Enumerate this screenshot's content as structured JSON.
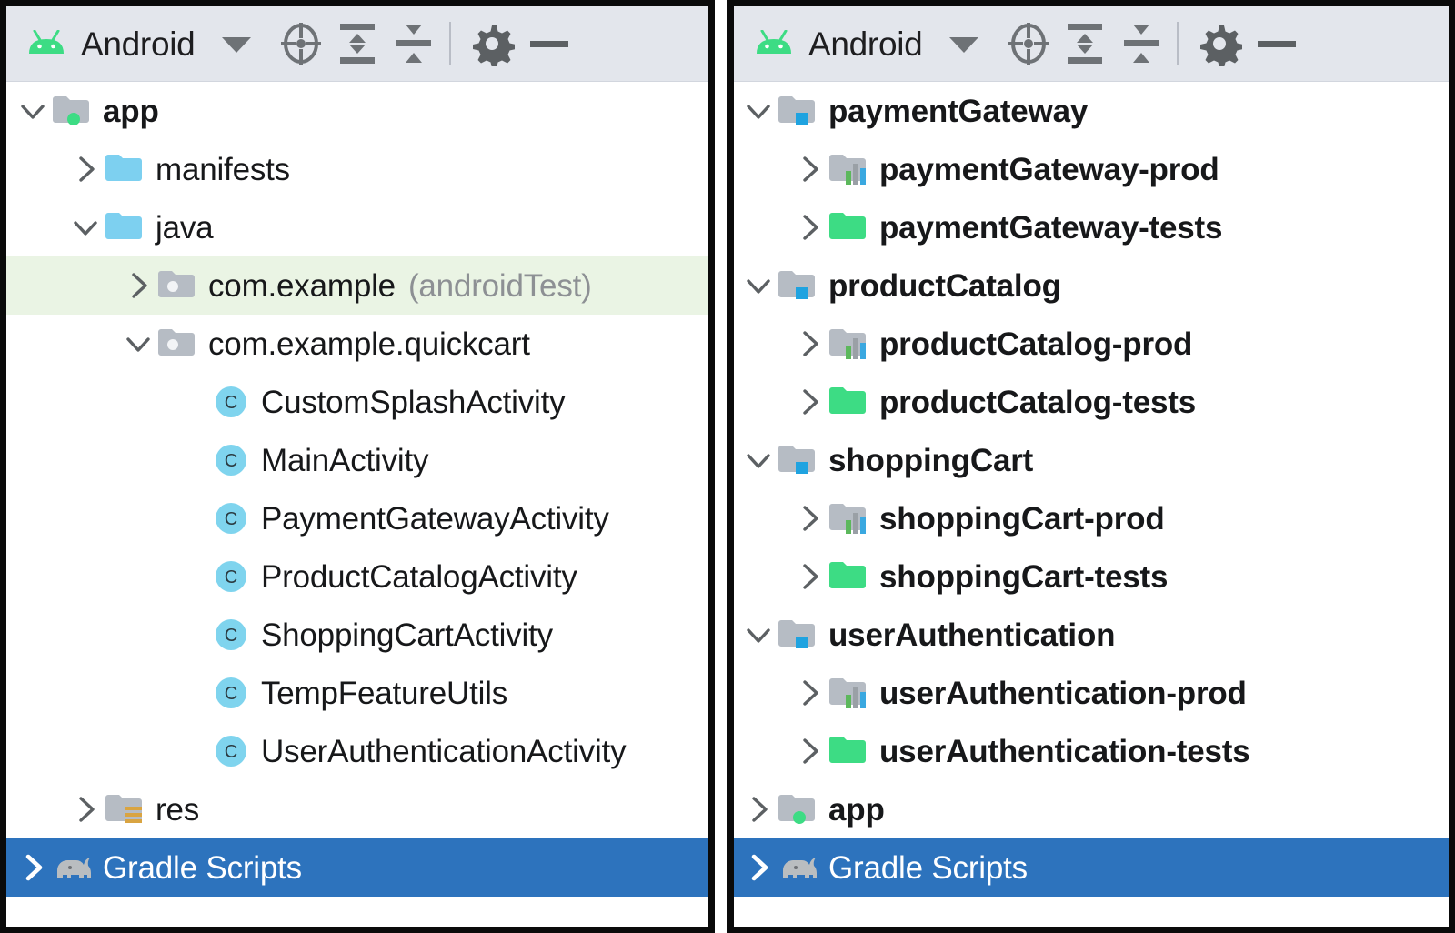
{
  "colors": {
    "toolbar_bg": "#e3e6ec",
    "panel_border": "#0a0a0a",
    "selection_blue": "#2d73bd",
    "highlight_green": "#eaf4e4",
    "folder_gray": "#b6bcc4",
    "folder_blue": "#7dd0f0",
    "folder_green": "#3ddc84",
    "badge_blue": "#1fa3e0",
    "badge_green": "#3ddc84",
    "class_icon_bg": "#7fd4ee",
    "text": "#17181a",
    "text_muted": "#8d9094",
    "android_green": "#3ddc84",
    "res_badge": "#d9a441"
  },
  "left_panel": {
    "toolbar": {
      "title": "Android",
      "dropdown_caret": "chevron-down-icon",
      "buttons": [
        {
          "name": "select-opened-file-icon",
          "tooltip": "Select Opened File"
        },
        {
          "name": "expand-all-icon",
          "tooltip": "Expand All"
        },
        {
          "name": "collapse-all-icon",
          "tooltip": "Collapse All"
        },
        {
          "name": "settings-gear-icon",
          "tooltip": "Settings"
        },
        {
          "name": "hide-minus-icon",
          "tooltip": "Hide"
        }
      ]
    },
    "rows": [
      {
        "label": "app",
        "sub": "",
        "indent": 0,
        "twisty": "down",
        "icon": "module-folder-green-dot",
        "bold": true,
        "state": "none"
      },
      {
        "label": "manifests",
        "sub": "",
        "indent": 1,
        "twisty": "right",
        "icon": "folder-blue",
        "bold": false,
        "state": "none"
      },
      {
        "label": "java",
        "sub": "",
        "indent": 1,
        "twisty": "down",
        "icon": "folder-blue",
        "bold": false,
        "state": "none"
      },
      {
        "label": "com.example",
        "sub": "(androidTest)",
        "indent": 2,
        "twisty": "right",
        "icon": "package-folder",
        "bold": false,
        "state": "green"
      },
      {
        "label": "com.example.quickcart",
        "sub": "",
        "indent": 2,
        "twisty": "down",
        "icon": "package-folder",
        "bold": false,
        "state": "none"
      },
      {
        "label": "CustomSplashActivity",
        "sub": "",
        "indent": 3,
        "twisty": "none",
        "icon": "class-icon",
        "bold": false,
        "state": "none"
      },
      {
        "label": "MainActivity",
        "sub": "",
        "indent": 3,
        "twisty": "none",
        "icon": "class-icon",
        "bold": false,
        "state": "none"
      },
      {
        "label": "PaymentGatewayActivity",
        "sub": "",
        "indent": 3,
        "twisty": "none",
        "icon": "class-icon",
        "bold": false,
        "state": "none"
      },
      {
        "label": "ProductCatalogActivity",
        "sub": "",
        "indent": 3,
        "twisty": "none",
        "icon": "class-icon",
        "bold": false,
        "state": "none"
      },
      {
        "label": "ShoppingCartActivity",
        "sub": "",
        "indent": 3,
        "twisty": "none",
        "icon": "class-icon",
        "bold": false,
        "state": "none"
      },
      {
        "label": "TempFeatureUtils",
        "sub": "",
        "indent": 3,
        "twisty": "none",
        "icon": "class-icon",
        "bold": false,
        "state": "none"
      },
      {
        "label": "UserAuthenticationActivity",
        "sub": "",
        "indent": 3,
        "twisty": "none",
        "icon": "class-icon",
        "bold": false,
        "state": "none"
      },
      {
        "label": "res",
        "sub": "",
        "indent": 1,
        "twisty": "right",
        "icon": "res-folder",
        "bold": false,
        "state": "none"
      },
      {
        "label": "Gradle Scripts",
        "sub": "",
        "indent": 0,
        "twisty": "right",
        "icon": "gradle-elephant-icon",
        "bold": false,
        "state": "blue"
      }
    ]
  },
  "right_panel": {
    "toolbar": {
      "title": "Android",
      "dropdown_caret": "chevron-down-icon",
      "buttons": [
        {
          "name": "select-opened-file-icon",
          "tooltip": "Select Opened File"
        },
        {
          "name": "expand-all-icon",
          "tooltip": "Expand All"
        },
        {
          "name": "collapse-all-icon",
          "tooltip": "Collapse All"
        },
        {
          "name": "settings-gear-icon",
          "tooltip": "Settings"
        },
        {
          "name": "hide-minus-icon",
          "tooltip": "Hide"
        }
      ]
    },
    "rows": [
      {
        "label": "paymentGateway",
        "indent": 0,
        "twisty": "down",
        "icon": "module-folder-blue-badge",
        "bold": true,
        "state": "none"
      },
      {
        "label": "paymentGateway-prod",
        "indent": 1,
        "twisty": "right",
        "icon": "chart-folder",
        "bold": true,
        "state": "none"
      },
      {
        "label": "paymentGateway-tests",
        "indent": 1,
        "twisty": "right",
        "icon": "folder-green",
        "bold": true,
        "state": "none"
      },
      {
        "label": "productCatalog",
        "indent": 0,
        "twisty": "down",
        "icon": "module-folder-blue-badge",
        "bold": true,
        "state": "none"
      },
      {
        "label": "productCatalog-prod",
        "indent": 1,
        "twisty": "right",
        "icon": "chart-folder",
        "bold": true,
        "state": "none"
      },
      {
        "label": "productCatalog-tests",
        "indent": 1,
        "twisty": "right",
        "icon": "folder-green",
        "bold": true,
        "state": "none"
      },
      {
        "label": "shoppingCart",
        "indent": 0,
        "twisty": "down",
        "icon": "module-folder-blue-badge",
        "bold": true,
        "state": "none"
      },
      {
        "label": "shoppingCart-prod",
        "indent": 1,
        "twisty": "right",
        "icon": "chart-folder",
        "bold": true,
        "state": "none"
      },
      {
        "label": "shoppingCart-tests",
        "indent": 1,
        "twisty": "right",
        "icon": "folder-green",
        "bold": true,
        "state": "none"
      },
      {
        "label": "userAuthentication",
        "indent": 0,
        "twisty": "down",
        "icon": "module-folder-blue-badge",
        "bold": true,
        "state": "none"
      },
      {
        "label": "userAuthentication-prod",
        "indent": 1,
        "twisty": "right",
        "icon": "chart-folder",
        "bold": true,
        "state": "none"
      },
      {
        "label": "userAuthentication-tests",
        "indent": 1,
        "twisty": "right",
        "icon": "folder-green",
        "bold": true,
        "state": "none"
      },
      {
        "label": "app",
        "indent": 0,
        "twisty": "right",
        "icon": "module-folder-green-dot",
        "bold": true,
        "state": "none"
      },
      {
        "label": "Gradle Scripts",
        "indent": 0,
        "twisty": "right",
        "icon": "gradle-elephant-icon",
        "bold": false,
        "state": "blue"
      }
    ]
  }
}
